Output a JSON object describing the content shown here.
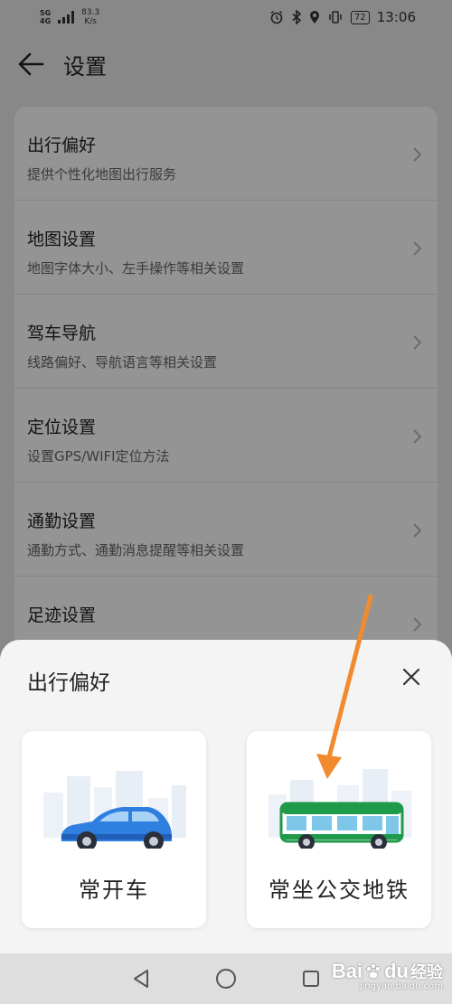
{
  "status_bar": {
    "network_top": "5G",
    "network_bottom": "4G",
    "speed_value": "83.3",
    "speed_unit": "K/s",
    "battery": "72",
    "time": "13:06"
  },
  "header": {
    "title": "设置"
  },
  "settings": [
    {
      "title": "出行偏好",
      "subtitle": "提供个性化地图出行服务"
    },
    {
      "title": "地图设置",
      "subtitle": "地图字体大小、左手操作等相关设置"
    },
    {
      "title": "驾车导航",
      "subtitle": "线路偏好、导航语言等相关设置"
    },
    {
      "title": "定位设置",
      "subtitle": "设置GPS/WIFI定位方法"
    },
    {
      "title": "通勤设置",
      "subtitle": "通勤方式、通勤消息提醒等相关设置"
    },
    {
      "title": "足迹设置",
      "subtitle": ""
    }
  ],
  "sheet": {
    "title": "出行偏好",
    "options": [
      {
        "label": "常开车",
        "icon": "car-icon"
      },
      {
        "label": "常坐公交地铁",
        "icon": "bus-icon"
      }
    ]
  },
  "annotation": {
    "arrow_color": "#f28a2e"
  },
  "watermark": {
    "brand": "Bai",
    "brand_suffix": "du",
    "text": "经验",
    "url": "jingyan.baidu.com"
  },
  "colors": {
    "accent_blue": "#2f7fe0",
    "bus_green": "#1f9a4a"
  }
}
